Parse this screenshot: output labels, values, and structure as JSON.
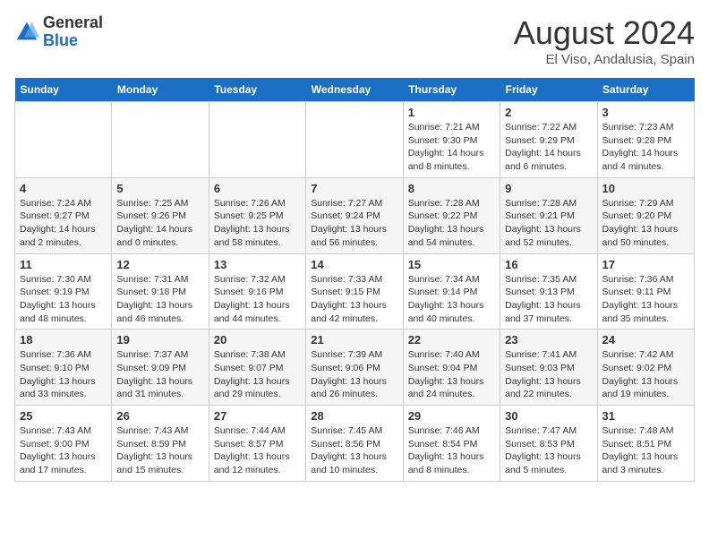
{
  "logo": {
    "general": "General",
    "blue": "Blue"
  },
  "title": {
    "month_year": "August 2024",
    "location": "El Viso, Andalusia, Spain"
  },
  "days_of_week": [
    "Sunday",
    "Monday",
    "Tuesday",
    "Wednesday",
    "Thursday",
    "Friday",
    "Saturday"
  ],
  "weeks": [
    [
      {
        "day": "",
        "info": ""
      },
      {
        "day": "",
        "info": ""
      },
      {
        "day": "",
        "info": ""
      },
      {
        "day": "",
        "info": ""
      },
      {
        "day": "1",
        "info": "Sunrise: 7:21 AM\nSunset: 9:30 PM\nDaylight: 14 hours\nand 8 minutes."
      },
      {
        "day": "2",
        "info": "Sunrise: 7:22 AM\nSunset: 9:29 PM\nDaylight: 14 hours\nand 6 minutes."
      },
      {
        "day": "3",
        "info": "Sunrise: 7:23 AM\nSunset: 9:28 PM\nDaylight: 14 hours\nand 4 minutes."
      }
    ],
    [
      {
        "day": "4",
        "info": "Sunrise: 7:24 AM\nSunset: 9:27 PM\nDaylight: 14 hours\nand 2 minutes."
      },
      {
        "day": "5",
        "info": "Sunrise: 7:25 AM\nSunset: 9:26 PM\nDaylight: 14 hours\nand 0 minutes."
      },
      {
        "day": "6",
        "info": "Sunrise: 7:26 AM\nSunset: 9:25 PM\nDaylight: 13 hours\nand 58 minutes."
      },
      {
        "day": "7",
        "info": "Sunrise: 7:27 AM\nSunset: 9:24 PM\nDaylight: 13 hours\nand 56 minutes."
      },
      {
        "day": "8",
        "info": "Sunrise: 7:28 AM\nSunset: 9:22 PM\nDaylight: 13 hours\nand 54 minutes."
      },
      {
        "day": "9",
        "info": "Sunrise: 7:28 AM\nSunset: 9:21 PM\nDaylight: 13 hours\nand 52 minutes."
      },
      {
        "day": "10",
        "info": "Sunrise: 7:29 AM\nSunset: 9:20 PM\nDaylight: 13 hours\nand 50 minutes."
      }
    ],
    [
      {
        "day": "11",
        "info": "Sunrise: 7:30 AM\nSunset: 9:19 PM\nDaylight: 13 hours\nand 48 minutes."
      },
      {
        "day": "12",
        "info": "Sunrise: 7:31 AM\nSunset: 9:18 PM\nDaylight: 13 hours\nand 46 minutes."
      },
      {
        "day": "13",
        "info": "Sunrise: 7:32 AM\nSunset: 9:16 PM\nDaylight: 13 hours\nand 44 minutes."
      },
      {
        "day": "14",
        "info": "Sunrise: 7:33 AM\nSunset: 9:15 PM\nDaylight: 13 hours\nand 42 minutes."
      },
      {
        "day": "15",
        "info": "Sunrise: 7:34 AM\nSunset: 9:14 PM\nDaylight: 13 hours\nand 40 minutes."
      },
      {
        "day": "16",
        "info": "Sunrise: 7:35 AM\nSunset: 9:13 PM\nDaylight: 13 hours\nand 37 minutes."
      },
      {
        "day": "17",
        "info": "Sunrise: 7:36 AM\nSunset: 9:11 PM\nDaylight: 13 hours\nand 35 minutes."
      }
    ],
    [
      {
        "day": "18",
        "info": "Sunrise: 7:36 AM\nSunset: 9:10 PM\nDaylight: 13 hours\nand 33 minutes."
      },
      {
        "day": "19",
        "info": "Sunrise: 7:37 AM\nSunset: 9:09 PM\nDaylight: 13 hours\nand 31 minutes."
      },
      {
        "day": "20",
        "info": "Sunrise: 7:38 AM\nSunset: 9:07 PM\nDaylight: 13 hours\nand 29 minutes."
      },
      {
        "day": "21",
        "info": "Sunrise: 7:39 AM\nSunset: 9:06 PM\nDaylight: 13 hours\nand 26 minutes."
      },
      {
        "day": "22",
        "info": "Sunrise: 7:40 AM\nSunset: 9:04 PM\nDaylight: 13 hours\nand 24 minutes."
      },
      {
        "day": "23",
        "info": "Sunrise: 7:41 AM\nSunset: 9:03 PM\nDaylight: 13 hours\nand 22 minutes."
      },
      {
        "day": "24",
        "info": "Sunrise: 7:42 AM\nSunset: 9:02 PM\nDaylight: 13 hours\nand 19 minutes."
      }
    ],
    [
      {
        "day": "25",
        "info": "Sunrise: 7:43 AM\nSunset: 9:00 PM\nDaylight: 13 hours\nand 17 minutes."
      },
      {
        "day": "26",
        "info": "Sunrise: 7:43 AM\nSunset: 8:59 PM\nDaylight: 13 hours\nand 15 minutes."
      },
      {
        "day": "27",
        "info": "Sunrise: 7:44 AM\nSunset: 8:57 PM\nDaylight: 13 hours\nand 12 minutes."
      },
      {
        "day": "28",
        "info": "Sunrise: 7:45 AM\nSunset: 8:56 PM\nDaylight: 13 hours\nand 10 minutes."
      },
      {
        "day": "29",
        "info": "Sunrise: 7:46 AM\nSunset: 8:54 PM\nDaylight: 13 hours\nand 8 minutes."
      },
      {
        "day": "30",
        "info": "Sunrise: 7:47 AM\nSunset: 8:53 PM\nDaylight: 13 hours\nand 5 minutes."
      },
      {
        "day": "31",
        "info": "Sunrise: 7:48 AM\nSunset: 8:51 PM\nDaylight: 13 hours\nand 3 minutes."
      }
    ]
  ]
}
